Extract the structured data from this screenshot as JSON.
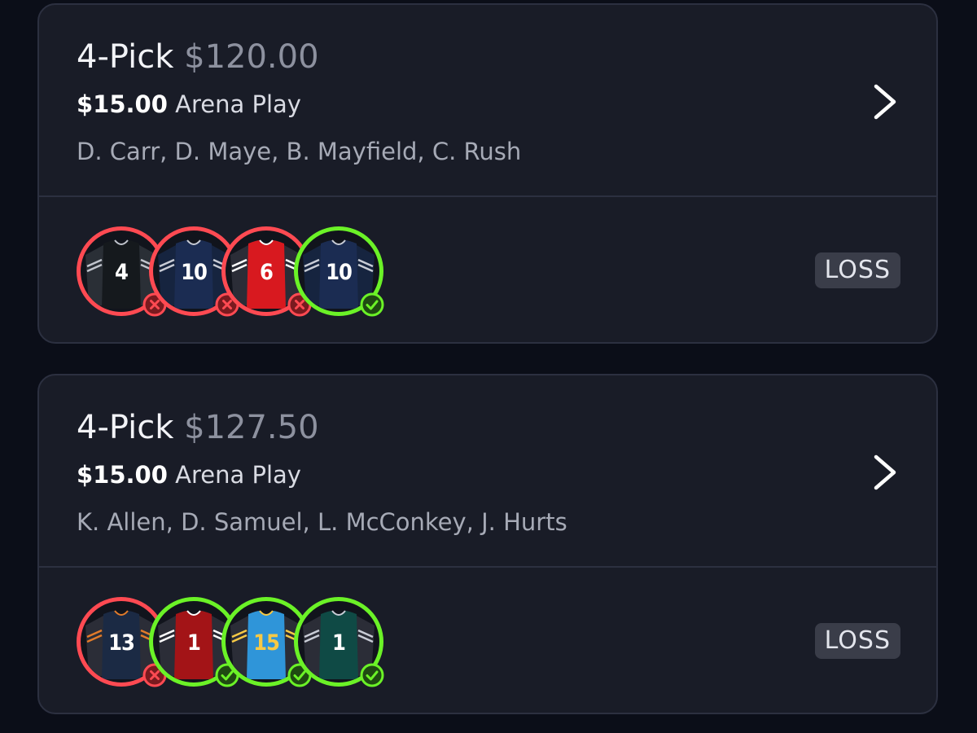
{
  "entries": [
    {
      "pick_type": "4-Pick",
      "payout": "$120.00",
      "entry_amount": "$15.00",
      "entry_label": "Arena Play",
      "players": "D. Carr, D. Maye, B. Mayfield, C. Rush",
      "result": "LOSS",
      "picks": [
        {
          "number": "4",
          "result": "loss",
          "jersey_color": "#15191d",
          "sleeve_color": "#2a2f36",
          "stripe_color": "#c0c4cc",
          "number_color": "#ffffff"
        },
        {
          "number": "10",
          "result": "loss",
          "jersey_color": "#1b2c52",
          "sleeve_color": "#16243f",
          "stripe_color": "#c8ccd6",
          "number_color": "#ffffff"
        },
        {
          "number": "6",
          "result": "loss",
          "jersey_color": "#d8191f",
          "sleeve_color": "#2b2d37",
          "stripe_color": "#ffffff",
          "number_color": "#ffffff"
        },
        {
          "number": "10",
          "result": "win",
          "jersey_color": "#1b2c52",
          "sleeve_color": "#16243f",
          "stripe_color": "#c8ccd6",
          "number_color": "#ffffff"
        }
      ]
    },
    {
      "pick_type": "4-Pick",
      "payout": "$127.50",
      "entry_amount": "$15.00",
      "entry_label": "Arena Play",
      "players": "K. Allen, D. Samuel, L. McConkey, J. Hurts",
      "result": "LOSS",
      "picks": [
        {
          "number": "13",
          "result": "loss",
          "jersey_color": "#1b2a44",
          "sleeve_color": "#2b2d37",
          "stripe_color": "#e27b2a",
          "number_color": "#ffffff"
        },
        {
          "number": "1",
          "result": "win",
          "jersey_color": "#a31417",
          "sleeve_color": "#2b2d37",
          "stripe_color": "#ffffff",
          "number_color": "#ffffff"
        },
        {
          "number": "15",
          "result": "win",
          "jersey_color": "#2f95d9",
          "sleeve_color": "#2b2d37",
          "stripe_color": "#f6c945",
          "number_color": "#f6c945"
        },
        {
          "number": "1",
          "result": "win",
          "jersey_color": "#0f4a45",
          "sleeve_color": "#2b2d37",
          "stripe_color": "#c8ccd6",
          "number_color": "#ffffff"
        }
      ]
    }
  ],
  "colors": {
    "loss": "#ff4a52",
    "win": "#6bf227",
    "loss_bg": "#7a1a1f",
    "win_bg": "#1f4a12"
  },
  "icons": {
    "chevron": "chevron-right-icon",
    "loss_badge": "x-circle-icon",
    "win_badge": "check-circle-icon"
  }
}
